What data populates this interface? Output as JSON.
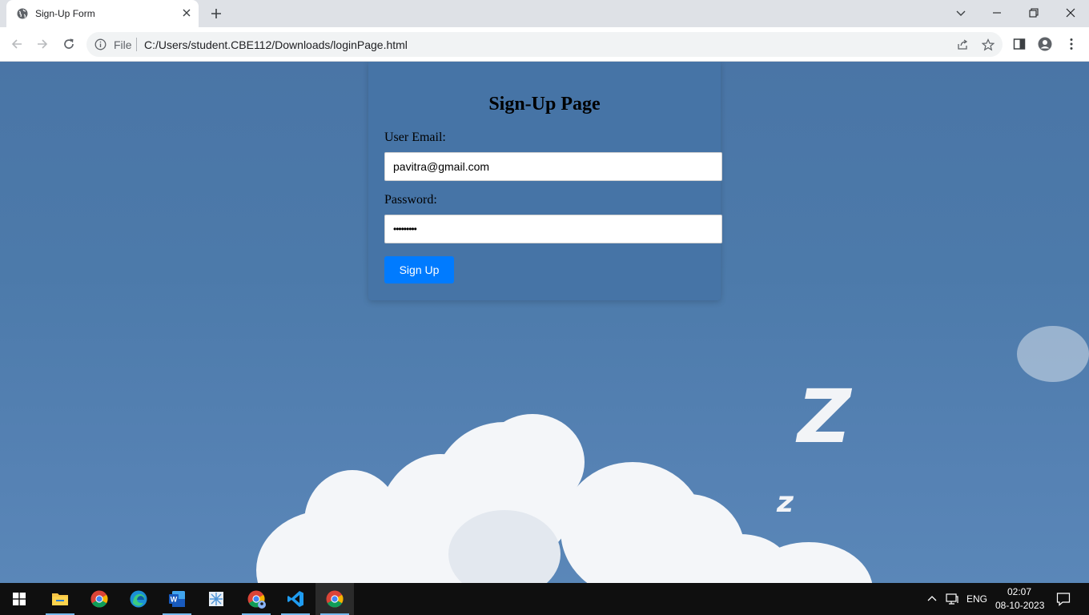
{
  "browser": {
    "tab_title": "Sign-Up Form",
    "omnibox": {
      "scheme_label": "File",
      "url": "C:/Users/student.CBE112/Downloads/loginPage.html"
    }
  },
  "form": {
    "title": "Sign-Up Page",
    "email_label": "User Email:",
    "email_value": "pavitra@gmail.com",
    "password_label": "Password:",
    "password_masked": "•••••••••",
    "submit_label": "Sign Up"
  },
  "taskbar": {
    "apps": [
      "start-icon",
      "file-explorer-icon",
      "chrome-icon",
      "edge-icon",
      "word-icon",
      "snipping-icon",
      "chrome-profile-icon",
      "vscode-icon",
      "chrome-active-icon"
    ],
    "language": "ENG",
    "time": "02:07",
    "date": "08-10-2023"
  },
  "colors": {
    "accent": "#007bff",
    "sky": "#4a78aa",
    "taskbar": "#0f0f0f"
  }
}
